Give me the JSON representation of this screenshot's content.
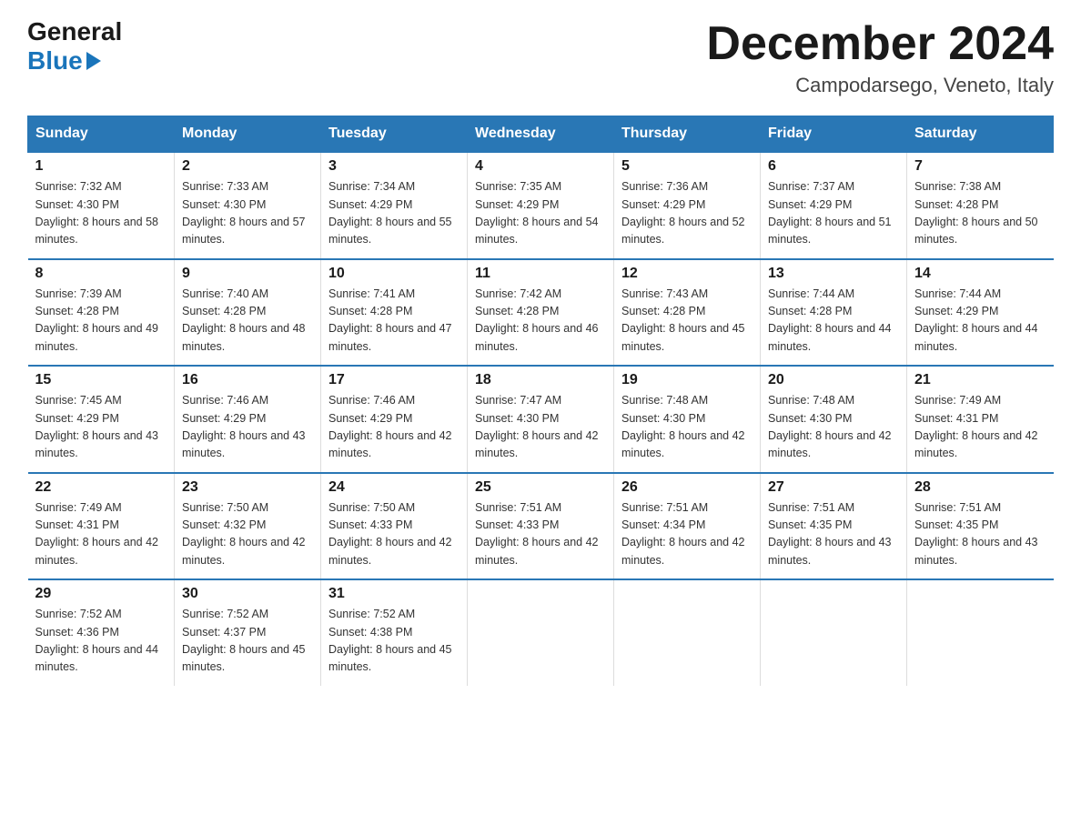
{
  "header": {
    "logo_general": "General",
    "logo_blue": "Blue",
    "month_title": "December 2024",
    "location": "Campodarsego, Veneto, Italy"
  },
  "days_of_week": [
    "Sunday",
    "Monday",
    "Tuesday",
    "Wednesday",
    "Thursday",
    "Friday",
    "Saturday"
  ],
  "weeks": [
    [
      {
        "day": "1",
        "sunrise": "7:32 AM",
        "sunset": "4:30 PM",
        "daylight": "8 hours and 58 minutes."
      },
      {
        "day": "2",
        "sunrise": "7:33 AM",
        "sunset": "4:30 PM",
        "daylight": "8 hours and 57 minutes."
      },
      {
        "day": "3",
        "sunrise": "7:34 AM",
        "sunset": "4:29 PM",
        "daylight": "8 hours and 55 minutes."
      },
      {
        "day": "4",
        "sunrise": "7:35 AM",
        "sunset": "4:29 PM",
        "daylight": "8 hours and 54 minutes."
      },
      {
        "day": "5",
        "sunrise": "7:36 AM",
        "sunset": "4:29 PM",
        "daylight": "8 hours and 52 minutes."
      },
      {
        "day": "6",
        "sunrise": "7:37 AM",
        "sunset": "4:29 PM",
        "daylight": "8 hours and 51 minutes."
      },
      {
        "day": "7",
        "sunrise": "7:38 AM",
        "sunset": "4:28 PM",
        "daylight": "8 hours and 50 minutes."
      }
    ],
    [
      {
        "day": "8",
        "sunrise": "7:39 AM",
        "sunset": "4:28 PM",
        "daylight": "8 hours and 49 minutes."
      },
      {
        "day": "9",
        "sunrise": "7:40 AM",
        "sunset": "4:28 PM",
        "daylight": "8 hours and 48 minutes."
      },
      {
        "day": "10",
        "sunrise": "7:41 AM",
        "sunset": "4:28 PM",
        "daylight": "8 hours and 47 minutes."
      },
      {
        "day": "11",
        "sunrise": "7:42 AM",
        "sunset": "4:28 PM",
        "daylight": "8 hours and 46 minutes."
      },
      {
        "day": "12",
        "sunrise": "7:43 AM",
        "sunset": "4:28 PM",
        "daylight": "8 hours and 45 minutes."
      },
      {
        "day": "13",
        "sunrise": "7:44 AM",
        "sunset": "4:28 PM",
        "daylight": "8 hours and 44 minutes."
      },
      {
        "day": "14",
        "sunrise": "7:44 AM",
        "sunset": "4:29 PM",
        "daylight": "8 hours and 44 minutes."
      }
    ],
    [
      {
        "day": "15",
        "sunrise": "7:45 AM",
        "sunset": "4:29 PM",
        "daylight": "8 hours and 43 minutes."
      },
      {
        "day": "16",
        "sunrise": "7:46 AM",
        "sunset": "4:29 PM",
        "daylight": "8 hours and 43 minutes."
      },
      {
        "day": "17",
        "sunrise": "7:46 AM",
        "sunset": "4:29 PM",
        "daylight": "8 hours and 42 minutes."
      },
      {
        "day": "18",
        "sunrise": "7:47 AM",
        "sunset": "4:30 PM",
        "daylight": "8 hours and 42 minutes."
      },
      {
        "day": "19",
        "sunrise": "7:48 AM",
        "sunset": "4:30 PM",
        "daylight": "8 hours and 42 minutes."
      },
      {
        "day": "20",
        "sunrise": "7:48 AM",
        "sunset": "4:30 PM",
        "daylight": "8 hours and 42 minutes."
      },
      {
        "day": "21",
        "sunrise": "7:49 AM",
        "sunset": "4:31 PM",
        "daylight": "8 hours and 42 minutes."
      }
    ],
    [
      {
        "day": "22",
        "sunrise": "7:49 AM",
        "sunset": "4:31 PM",
        "daylight": "8 hours and 42 minutes."
      },
      {
        "day": "23",
        "sunrise": "7:50 AM",
        "sunset": "4:32 PM",
        "daylight": "8 hours and 42 minutes."
      },
      {
        "day": "24",
        "sunrise": "7:50 AM",
        "sunset": "4:33 PM",
        "daylight": "8 hours and 42 minutes."
      },
      {
        "day": "25",
        "sunrise": "7:51 AM",
        "sunset": "4:33 PM",
        "daylight": "8 hours and 42 minutes."
      },
      {
        "day": "26",
        "sunrise": "7:51 AM",
        "sunset": "4:34 PM",
        "daylight": "8 hours and 42 minutes."
      },
      {
        "day": "27",
        "sunrise": "7:51 AM",
        "sunset": "4:35 PM",
        "daylight": "8 hours and 43 minutes."
      },
      {
        "day": "28",
        "sunrise": "7:51 AM",
        "sunset": "4:35 PM",
        "daylight": "8 hours and 43 minutes."
      }
    ],
    [
      {
        "day": "29",
        "sunrise": "7:52 AM",
        "sunset": "4:36 PM",
        "daylight": "8 hours and 44 minutes."
      },
      {
        "day": "30",
        "sunrise": "7:52 AM",
        "sunset": "4:37 PM",
        "daylight": "8 hours and 45 minutes."
      },
      {
        "day": "31",
        "sunrise": "7:52 AM",
        "sunset": "4:38 PM",
        "daylight": "8 hours and 45 minutes."
      },
      null,
      null,
      null,
      null
    ]
  ]
}
